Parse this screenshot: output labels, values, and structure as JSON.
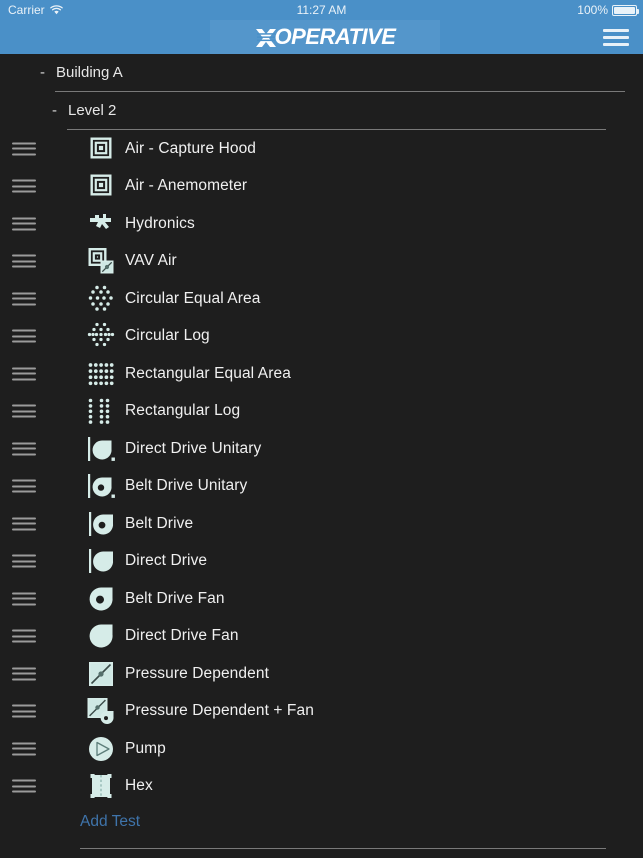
{
  "status_bar": {
    "carrier": "Carrier",
    "wifi_icon": "wifi-icon",
    "time": "11:27 AM",
    "battery_percent": "100%",
    "battery_icon": "battery-full-icon"
  },
  "nav_bar": {
    "logo_x": "X",
    "logo_text": "OPERATIVE",
    "menu_icon": "hamburger-menu-icon",
    "background_color": "#4a90c8"
  },
  "tree": {
    "building": {
      "disclosure": "-",
      "label": "Building A"
    },
    "level": {
      "disclosure": "-",
      "label": "Level 2"
    }
  },
  "tests": [
    {
      "label": "Air - Capture Hood",
      "icon": "concentric-squares-icon"
    },
    {
      "label": "Air - Anemometer",
      "icon": "concentric-squares-icon"
    },
    {
      "label": "Hydronics",
      "icon": "hydronic-valve-icon"
    },
    {
      "label": "VAV Air",
      "icon": "vav-box-icon"
    },
    {
      "label": "Circular Equal Area",
      "icon": "circular-equal-area-dots-icon"
    },
    {
      "label": "Circular Log",
      "icon": "circular-log-dots-icon"
    },
    {
      "label": "Rectangular Equal Area",
      "icon": "rectangular-equal-area-dots-icon"
    },
    {
      "label": "Rectangular Log",
      "icon": "rectangular-log-dots-icon"
    },
    {
      "label": "Direct Drive Unitary",
      "icon": "direct-drive-unitary-icon"
    },
    {
      "label": "Belt Drive Unitary",
      "icon": "belt-drive-unitary-icon"
    },
    {
      "label": "Belt Drive",
      "icon": "belt-drive-icon"
    },
    {
      "label": "Direct Drive",
      "icon": "direct-drive-icon"
    },
    {
      "label": "Belt Drive Fan",
      "icon": "belt-drive-fan-icon"
    },
    {
      "label": "Direct Drive Fan",
      "icon": "direct-drive-fan-icon"
    },
    {
      "label": "Pressure Dependent",
      "icon": "pressure-dependent-icon"
    },
    {
      "label": "Pressure Dependent + Fan",
      "icon": "pressure-dependent-fan-icon"
    },
    {
      "label": "Pump",
      "icon": "pump-icon"
    },
    {
      "label": "Hex",
      "icon": "heat-exchanger-icon"
    }
  ],
  "footer": {
    "add_test_label": "Add Test",
    "add_test_color": "#3f74ab"
  },
  "theme": {
    "background": "#1e1e1e",
    "accent": "#4a90c8",
    "icon_color": "#d6ece8",
    "text_color": "#f0f0f0"
  }
}
